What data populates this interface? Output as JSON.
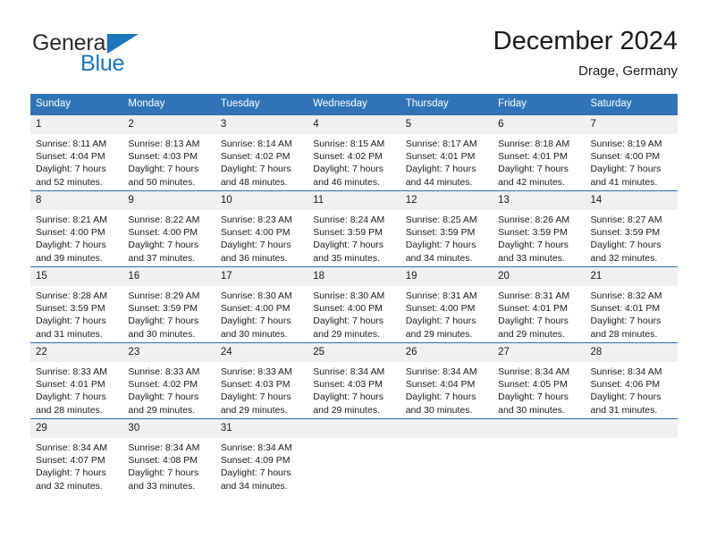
{
  "logo": {
    "word1": "General",
    "word2": "Blue",
    "accent_color": "#1b75bb",
    "triangle_icon": "triangle-icon"
  },
  "header": {
    "title": "December 2024",
    "subtitle": "Drage, Germany"
  },
  "theme": {
    "header_blue": "#3074b7",
    "row_divider_blue": "#2f6fae",
    "daynum_band": "#f0f0f0",
    "cell_background": "#ffffff",
    "text": "#1a1a1a"
  },
  "weekdays": [
    "Sunday",
    "Monday",
    "Tuesday",
    "Wednesday",
    "Thursday",
    "Friday",
    "Saturday"
  ],
  "weeks": [
    [
      {
        "day": "1",
        "sunrise": "Sunrise: 8:11 AM",
        "sunset": "Sunset: 4:04 PM",
        "daylight1": "Daylight: 7 hours",
        "daylight2": "and 52 minutes."
      },
      {
        "day": "2",
        "sunrise": "Sunrise: 8:13 AM",
        "sunset": "Sunset: 4:03 PM",
        "daylight1": "Daylight: 7 hours",
        "daylight2": "and 50 minutes."
      },
      {
        "day": "3",
        "sunrise": "Sunrise: 8:14 AM",
        "sunset": "Sunset: 4:02 PM",
        "daylight1": "Daylight: 7 hours",
        "daylight2": "and 48 minutes."
      },
      {
        "day": "4",
        "sunrise": "Sunrise: 8:15 AM",
        "sunset": "Sunset: 4:02 PM",
        "daylight1": "Daylight: 7 hours",
        "daylight2": "and 46 minutes."
      },
      {
        "day": "5",
        "sunrise": "Sunrise: 8:17 AM",
        "sunset": "Sunset: 4:01 PM",
        "daylight1": "Daylight: 7 hours",
        "daylight2": "and 44 minutes."
      },
      {
        "day": "6",
        "sunrise": "Sunrise: 8:18 AM",
        "sunset": "Sunset: 4:01 PM",
        "daylight1": "Daylight: 7 hours",
        "daylight2": "and 42 minutes."
      },
      {
        "day": "7",
        "sunrise": "Sunrise: 8:19 AM",
        "sunset": "Sunset: 4:00 PM",
        "daylight1": "Daylight: 7 hours",
        "daylight2": "and 41 minutes."
      }
    ],
    [
      {
        "day": "8",
        "sunrise": "Sunrise: 8:21 AM",
        "sunset": "Sunset: 4:00 PM",
        "daylight1": "Daylight: 7 hours",
        "daylight2": "and 39 minutes."
      },
      {
        "day": "9",
        "sunrise": "Sunrise: 8:22 AM",
        "sunset": "Sunset: 4:00 PM",
        "daylight1": "Daylight: 7 hours",
        "daylight2": "and 37 minutes."
      },
      {
        "day": "10",
        "sunrise": "Sunrise: 8:23 AM",
        "sunset": "Sunset: 4:00 PM",
        "daylight1": "Daylight: 7 hours",
        "daylight2": "and 36 minutes."
      },
      {
        "day": "11",
        "sunrise": "Sunrise: 8:24 AM",
        "sunset": "Sunset: 3:59 PM",
        "daylight1": "Daylight: 7 hours",
        "daylight2": "and 35 minutes."
      },
      {
        "day": "12",
        "sunrise": "Sunrise: 8:25 AM",
        "sunset": "Sunset: 3:59 PM",
        "daylight1": "Daylight: 7 hours",
        "daylight2": "and 34 minutes."
      },
      {
        "day": "13",
        "sunrise": "Sunrise: 8:26 AM",
        "sunset": "Sunset: 3:59 PM",
        "daylight1": "Daylight: 7 hours",
        "daylight2": "and 33 minutes."
      },
      {
        "day": "14",
        "sunrise": "Sunrise: 8:27 AM",
        "sunset": "Sunset: 3:59 PM",
        "daylight1": "Daylight: 7 hours",
        "daylight2": "and 32 minutes."
      }
    ],
    [
      {
        "day": "15",
        "sunrise": "Sunrise: 8:28 AM",
        "sunset": "Sunset: 3:59 PM",
        "daylight1": "Daylight: 7 hours",
        "daylight2": "and 31 minutes."
      },
      {
        "day": "16",
        "sunrise": "Sunrise: 8:29 AM",
        "sunset": "Sunset: 3:59 PM",
        "daylight1": "Daylight: 7 hours",
        "daylight2": "and 30 minutes."
      },
      {
        "day": "17",
        "sunrise": "Sunrise: 8:30 AM",
        "sunset": "Sunset: 4:00 PM",
        "daylight1": "Daylight: 7 hours",
        "daylight2": "and 30 minutes."
      },
      {
        "day": "18",
        "sunrise": "Sunrise: 8:30 AM",
        "sunset": "Sunset: 4:00 PM",
        "daylight1": "Daylight: 7 hours",
        "daylight2": "and 29 minutes."
      },
      {
        "day": "19",
        "sunrise": "Sunrise: 8:31 AM",
        "sunset": "Sunset: 4:00 PM",
        "daylight1": "Daylight: 7 hours",
        "daylight2": "and 29 minutes."
      },
      {
        "day": "20",
        "sunrise": "Sunrise: 8:31 AM",
        "sunset": "Sunset: 4:01 PM",
        "daylight1": "Daylight: 7 hours",
        "daylight2": "and 29 minutes."
      },
      {
        "day": "21",
        "sunrise": "Sunrise: 8:32 AM",
        "sunset": "Sunset: 4:01 PM",
        "daylight1": "Daylight: 7 hours",
        "daylight2": "and 28 minutes."
      }
    ],
    [
      {
        "day": "22",
        "sunrise": "Sunrise: 8:33 AM",
        "sunset": "Sunset: 4:01 PM",
        "daylight1": "Daylight: 7 hours",
        "daylight2": "and 28 minutes."
      },
      {
        "day": "23",
        "sunrise": "Sunrise: 8:33 AM",
        "sunset": "Sunset: 4:02 PM",
        "daylight1": "Daylight: 7 hours",
        "daylight2": "and 29 minutes."
      },
      {
        "day": "24",
        "sunrise": "Sunrise: 8:33 AM",
        "sunset": "Sunset: 4:03 PM",
        "daylight1": "Daylight: 7 hours",
        "daylight2": "and 29 minutes."
      },
      {
        "day": "25",
        "sunrise": "Sunrise: 8:34 AM",
        "sunset": "Sunset: 4:03 PM",
        "daylight1": "Daylight: 7 hours",
        "daylight2": "and 29 minutes."
      },
      {
        "day": "26",
        "sunrise": "Sunrise: 8:34 AM",
        "sunset": "Sunset: 4:04 PM",
        "daylight1": "Daylight: 7 hours",
        "daylight2": "and 30 minutes."
      },
      {
        "day": "27",
        "sunrise": "Sunrise: 8:34 AM",
        "sunset": "Sunset: 4:05 PM",
        "daylight1": "Daylight: 7 hours",
        "daylight2": "and 30 minutes."
      },
      {
        "day": "28",
        "sunrise": "Sunrise: 8:34 AM",
        "sunset": "Sunset: 4:06 PM",
        "daylight1": "Daylight: 7 hours",
        "daylight2": "and 31 minutes."
      }
    ],
    [
      {
        "day": "29",
        "sunrise": "Sunrise: 8:34 AM",
        "sunset": "Sunset: 4:07 PM",
        "daylight1": "Daylight: 7 hours",
        "daylight2": "and 32 minutes."
      },
      {
        "day": "30",
        "sunrise": "Sunrise: 8:34 AM",
        "sunset": "Sunset: 4:08 PM",
        "daylight1": "Daylight: 7 hours",
        "daylight2": "and 33 minutes."
      },
      {
        "day": "31",
        "sunrise": "Sunrise: 8:34 AM",
        "sunset": "Sunset: 4:09 PM",
        "daylight1": "Daylight: 7 hours",
        "daylight2": "and 34 minutes."
      },
      {
        "day": "",
        "sunrise": "",
        "sunset": "",
        "daylight1": "",
        "daylight2": ""
      },
      {
        "day": "",
        "sunrise": "",
        "sunset": "",
        "daylight1": "",
        "daylight2": ""
      },
      {
        "day": "",
        "sunrise": "",
        "sunset": "",
        "daylight1": "",
        "daylight2": ""
      },
      {
        "day": "",
        "sunrise": "",
        "sunset": "",
        "daylight1": "",
        "daylight2": ""
      }
    ]
  ]
}
